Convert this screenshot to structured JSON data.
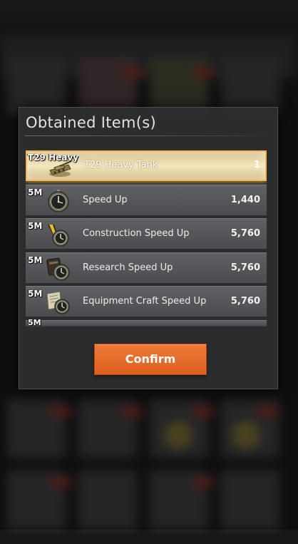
{
  "dialog": {
    "title": "Obtained Item(s)",
    "confirm_label": "Confirm"
  },
  "items": [
    {
      "tag": "T29 Heavy",
      "name": "T29 Heavy Tank",
      "quantity": "1",
      "icon": "tank-icon",
      "highlighted": true
    },
    {
      "tag": "5M",
      "name": "Speed Up",
      "quantity": "1,440",
      "icon": "stopwatch-icon",
      "highlighted": false
    },
    {
      "tag": "5M",
      "name": "Construction Speed Up",
      "quantity": "5,760",
      "icon": "construction-stopwatch-icon",
      "highlighted": false
    },
    {
      "tag": "5M",
      "name": "Research Speed Up",
      "quantity": "5,760",
      "icon": "research-stopwatch-icon",
      "highlighted": false
    },
    {
      "tag": "5M",
      "name": "Equipment Craft Speed Up",
      "quantity": "5,760",
      "icon": "equipment-stopwatch-icon",
      "highlighted": false
    },
    {
      "tag": "5M",
      "name": "",
      "quantity": "",
      "icon": "",
      "highlighted": false
    }
  ],
  "colors": {
    "confirm": "#e8692a",
    "highlight_border": "#f0b94a",
    "panel": "#2c2e30"
  }
}
